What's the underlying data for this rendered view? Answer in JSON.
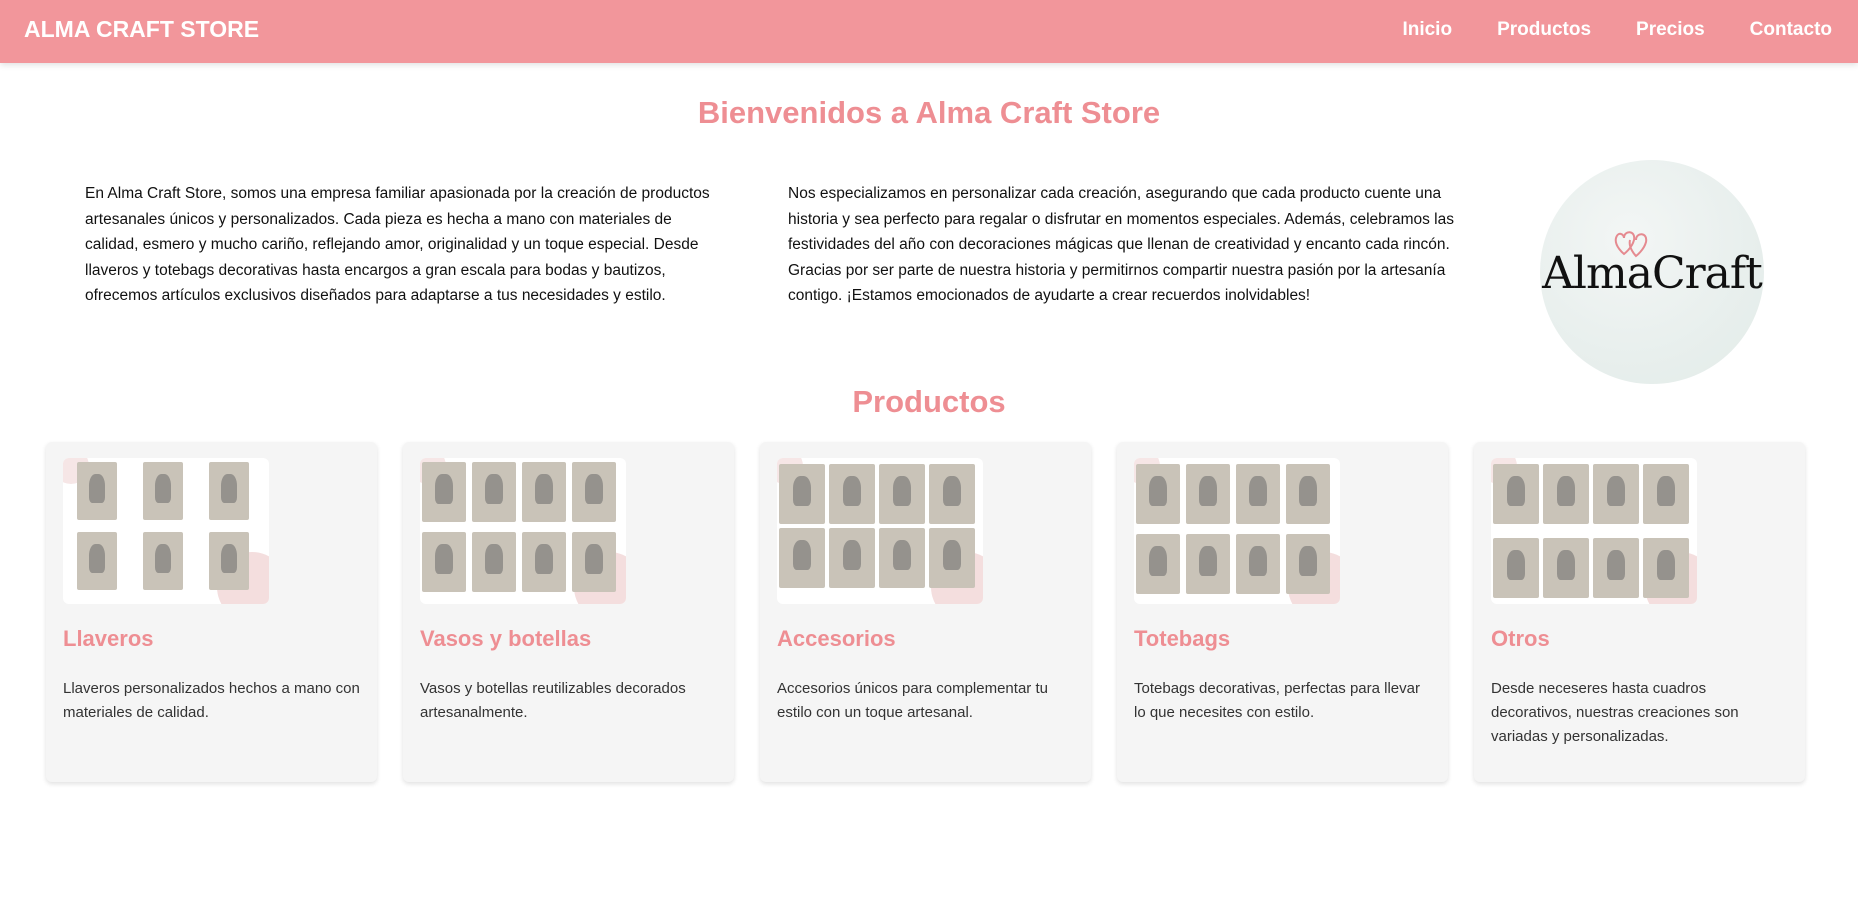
{
  "navbar": {
    "brand": "ALMA CRAFT STORE",
    "links": [
      "Inicio",
      "Productos",
      "Precios",
      "Contacto"
    ]
  },
  "welcome": {
    "title": "Bienvenidos a Alma Craft Store",
    "paragraph1": "En Alma Craft Store, somos una empresa familiar apasionada por la creación de productos artesanales únicos y personalizados. Cada pieza es hecha a mano con materiales de calidad, esmero y mucho cariño, reflejando amor, originalidad y un toque especial. Desde llaveros y totebags decorativas hasta encargos a gran escala para bodas y bautizos, ofrecemos artículos exclusivos diseñados para adaptarse a tus necesidades y estilo.",
    "paragraph2": "Nos especializamos en personalizar cada creación, asegurando que cada producto cuente una historia y sea perfecto para regalar o disfrutar en momentos especiales. Además, celebramos las festividades del año con decoraciones mágicas que llenan de creatividad y encanto cada rincón. Gracias por ser parte de nuestra historia y permitirnos compartir nuestra pasión por la artesanía contigo. ¡Estamos emocionados de ayudarte a crear recuerdos inolvidables!",
    "logo_text": "AlmaCraft"
  },
  "products": {
    "title": "Productos",
    "items": [
      {
        "name": "Llaveros",
        "description": "Llaveros personalizados hechos a mano con materiales de calidad."
      },
      {
        "name": "Vasos y botellas",
        "description": "Vasos y botellas reutilizables decorados artesanalmente."
      },
      {
        "name": "Accesorios",
        "description": "Accesorios únicos para complementar tu estilo con un toque artesanal."
      },
      {
        "name": "Totebags",
        "description": "Totebags decorativas, perfectas para llevar lo que necesites con estilo."
      },
      {
        "name": "Otros",
        "description": "Desde neceseres hasta cuadros decorativos, nuestras creaciones son variadas y personalizadas."
      }
    ]
  },
  "colors": {
    "accent": "#f2969b",
    "title_pink": "#ee8e93",
    "card_bg": "#f5f5f5"
  }
}
